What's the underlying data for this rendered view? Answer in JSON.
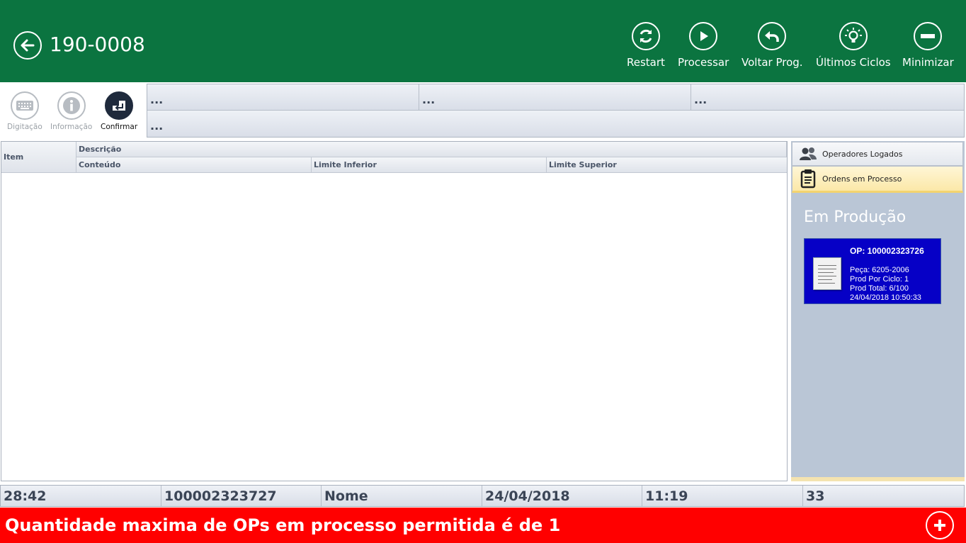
{
  "header": {
    "title": "190-0008",
    "back_icon": "arrow-left-icon",
    "tools": [
      {
        "label": "Restart",
        "icon": "restart-icon"
      },
      {
        "label": "Processar",
        "icon": "play-icon"
      },
      {
        "label": "Voltar Prog.",
        "icon": "undo-icon"
      },
      {
        "label": "Últimos Ciclos",
        "icon": "lightbulb-icon"
      },
      {
        "label": "Minimizar",
        "icon": "minus-icon"
      }
    ]
  },
  "toolbar": {
    "digitacao": "Digitação",
    "informacao": "Informação",
    "confirmar": "Confirmar"
  },
  "info_fields": [
    "...",
    "...",
    "...",
    "..."
  ],
  "table": {
    "col_item": "Item",
    "col_descricao": "Descrição",
    "col_conteudo": "Conteúdo",
    "col_limite_inferior": "Limite Inferior",
    "col_limite_superior": "Limite Superior",
    "rows": []
  },
  "right_panel": {
    "tab_operadores": "Operadores Logados",
    "tab_ordens": "Ordens em Processo",
    "section_title": "Em Produção",
    "op_card": {
      "title": "OP: 100002323726",
      "peca": "Peça: 6205-2006",
      "prod_por_ciclo": "Prod Por Ciclo: 1",
      "prod_total": "Prod Total: 6/100",
      "timestamp": "24/04/2018 10:50:33"
    }
  },
  "status": {
    "timer": "28:42",
    "op_number": "100002323727",
    "nome": "Nome",
    "date": "24/04/2018",
    "time": "11:19",
    "count": "33"
  },
  "alert": {
    "message": "Quantidade maxima de OPs em processo permitida é de 1",
    "color": "#ff0000"
  },
  "colors": {
    "header_green": "#0b7440",
    "op_card_blue": "#0600c6",
    "panel_blue_gray": "#bac6d6"
  }
}
